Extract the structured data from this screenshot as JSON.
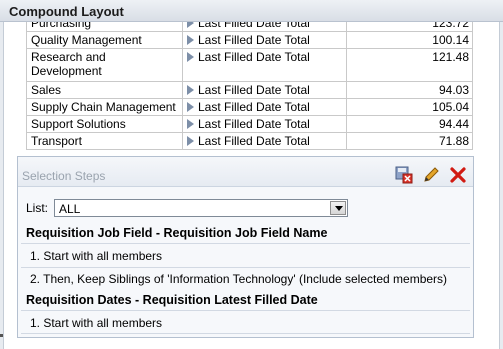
{
  "window": {
    "title": "Compound Layout"
  },
  "pivot": {
    "rows": [
      {
        "name": "Purchasing",
        "measure": "Last Filled Date Total",
        "value": "123.72"
      },
      {
        "name": "Quality Management",
        "measure": "Last Filled Date Total",
        "value": "100.14"
      },
      {
        "name": "Research and Development",
        "measure": "Last Filled Date Total",
        "value": "121.48"
      },
      {
        "name": "Sales",
        "measure": "Last Filled Date Total",
        "value": "94.03"
      },
      {
        "name": "Supply Chain Management",
        "measure": "Last Filled Date Total",
        "value": "105.04"
      },
      {
        "name": "Support Solutions",
        "measure": "Last Filled Date Total",
        "value": "94.44"
      },
      {
        "name": "Transport",
        "measure": "Last Filled Date Total",
        "value": "71.88"
      }
    ]
  },
  "selection_steps": {
    "header": "Selection Steps",
    "tools": [
      "save-icon",
      "edit-pencil-icon",
      "delete-x-icon"
    ],
    "list_label": "List:",
    "list_value": "ALL",
    "groups": [
      {
        "title": "Requisition Job Field - Requisition Job Field Name",
        "steps": [
          "1. Start with all members",
          "2. Then, Keep Siblings of 'Information Technology' (Include selected members)"
        ]
      },
      {
        "title": "Requisition Dates - Requisition Latest Filled Date",
        "steps": [
          "1. Start with all members"
        ]
      }
    ]
  }
}
